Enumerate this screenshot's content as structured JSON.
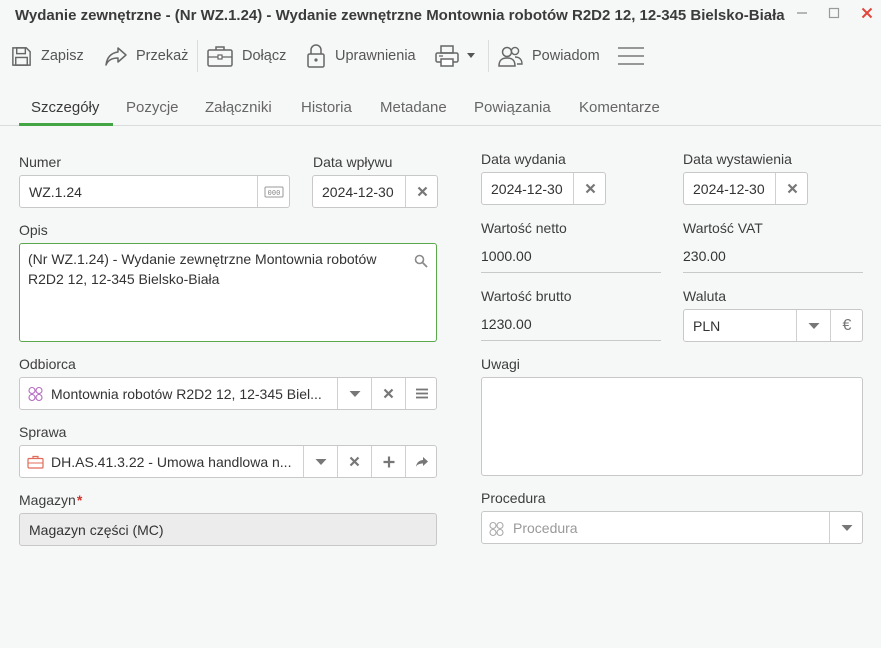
{
  "window": {
    "title": "Wydanie zewnętrzne - (Nr WZ.1.24) - Wydanie zewnętrzne Montownia robotów R2D2 12, 12-345 Bielsko-Biała",
    "minimize_icon": "minimize-icon",
    "maximize_icon": "maximize-icon",
    "close_icon": "close-icon",
    "close_color": "#e0463c"
  },
  "toolbar": {
    "save_label": "Zapisz",
    "forward_label": "Przekaż",
    "attach_label": "Dołącz",
    "permissions_label": "Uprawnienia",
    "notify_label": "Powiadom"
  },
  "tabs": [
    {
      "label": "Szczegóły",
      "active": true
    },
    {
      "label": "Pozycje"
    },
    {
      "label": "Załączniki"
    },
    {
      "label": "Historia"
    },
    {
      "label": "Metadane"
    },
    {
      "label": "Powiązania"
    },
    {
      "label": "Komentarze"
    }
  ],
  "accent_color": "#44a544",
  "form": {
    "numer": {
      "label": "Numer",
      "value": "WZ.1.24"
    },
    "data_wplywu": {
      "label": "Data wpływu",
      "value": "2024-12-30"
    },
    "opis": {
      "label": "Opis",
      "value": "(Nr WZ.1.24) - Wydanie zewnętrzne Montownia robotów R2D2 12, 12-345 Bielsko-Biała"
    },
    "odbiorca": {
      "label": "Odbiorca",
      "value": "Montownia robotów R2D2 12, 12-345 Biel..."
    },
    "sprawa": {
      "label": "Sprawa",
      "value": "DH.AS.41.3.22 - Umowa handlowa n..."
    },
    "magazyn": {
      "label": "Magazyn",
      "required_mark": "*",
      "value": "Magazyn części (MC)"
    },
    "data_wydania": {
      "label": "Data wydania",
      "value": "2024-12-30"
    },
    "data_wystawienia": {
      "label": "Data wystawienia",
      "value": "2024-12-30"
    },
    "wartosc_netto": {
      "label": "Wartość netto",
      "value": "1000.00"
    },
    "wartosc_vat": {
      "label": "Wartość VAT",
      "value": "230.00"
    },
    "wartosc_brutto": {
      "label": "Wartość brutto",
      "value": "1230.00"
    },
    "waluta": {
      "label": "Waluta",
      "value": "PLN",
      "currency_symbol": "€"
    },
    "uwagi": {
      "label": "Uwagi",
      "value": ""
    },
    "procedura": {
      "label": "Procedura",
      "placeholder": "Procedura"
    }
  }
}
